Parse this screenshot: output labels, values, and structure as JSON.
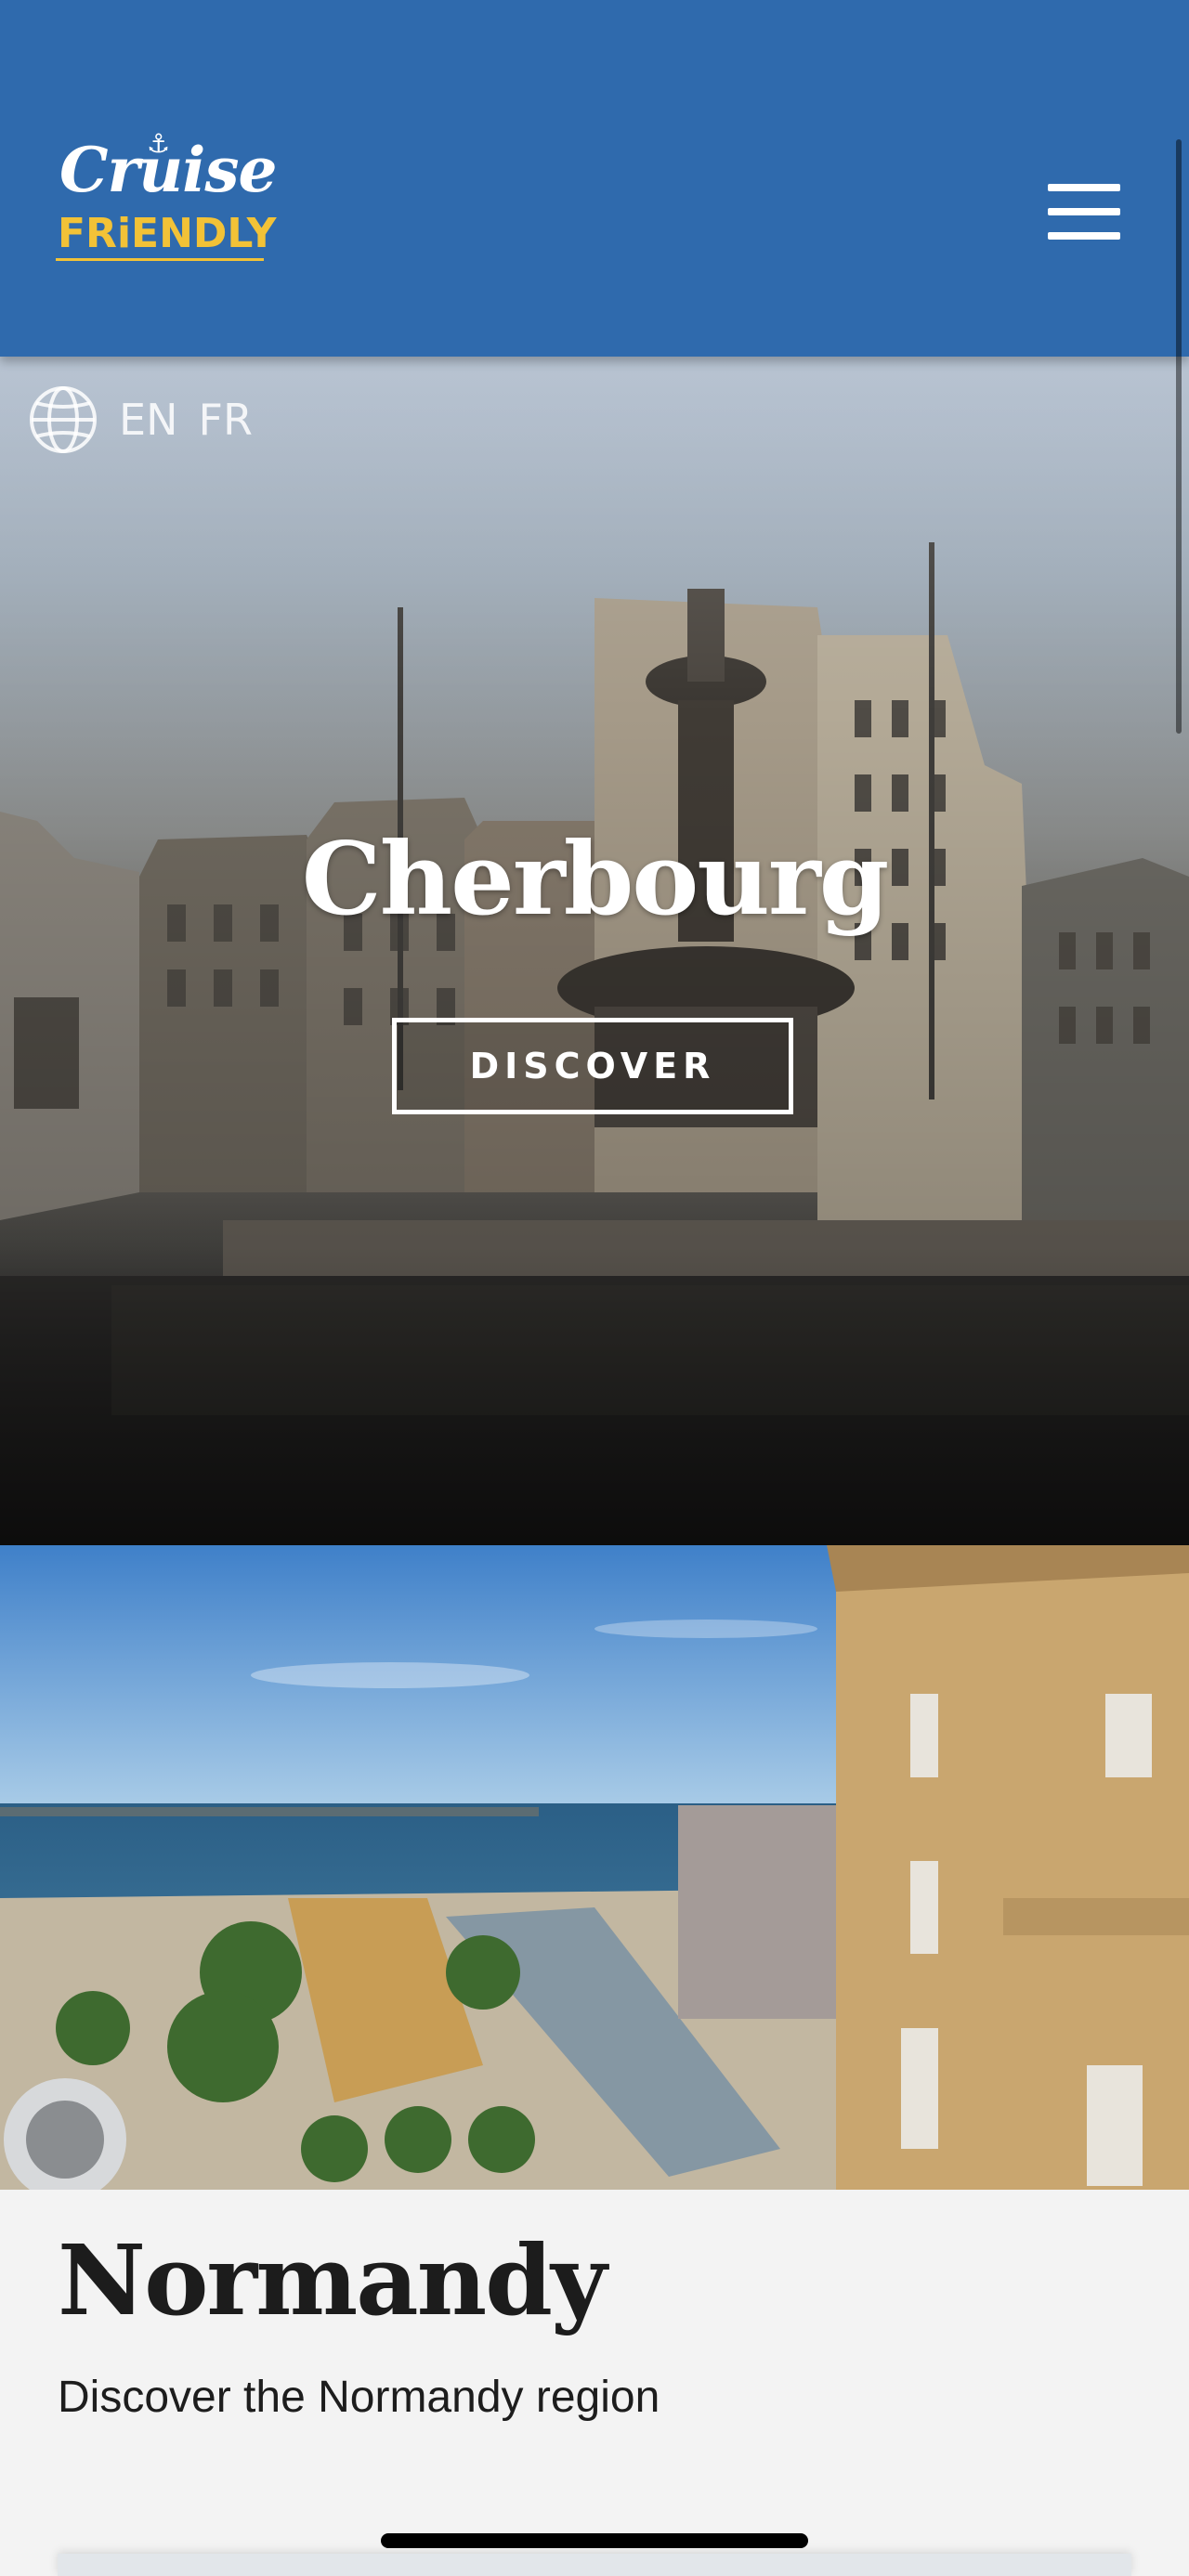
{
  "header": {
    "logo_top": "Cruise",
    "logo_bottom": "FRiENDLY",
    "menu_icon": "hamburger-menu-icon",
    "background_color": "#2f6aad",
    "accent_color": "#f2c237"
  },
  "language": {
    "icon": "globe-icon",
    "options": [
      "EN",
      "FR"
    ]
  },
  "hero": {
    "title": "Cherbourg",
    "button_label": "DISCOVER"
  },
  "normandy": {
    "title": "Normandy",
    "subtitle": "Discover the Normandy region"
  }
}
